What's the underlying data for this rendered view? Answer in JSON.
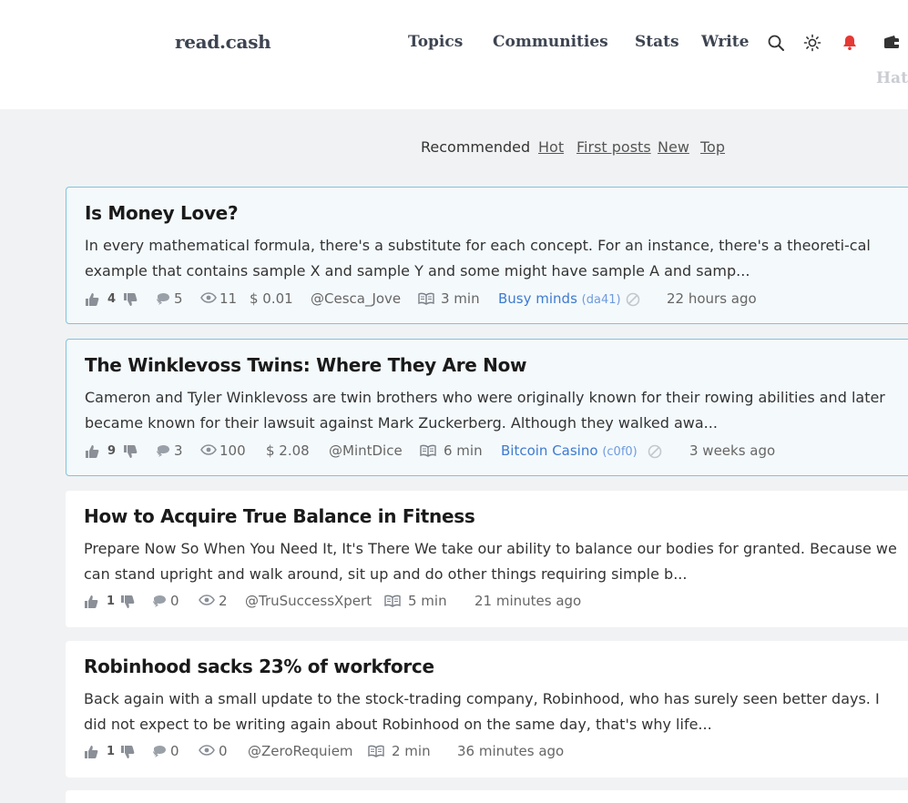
{
  "header": {
    "logo": "read.cash",
    "nav": [
      "Topics",
      "Communities",
      "Stats",
      "Write"
    ],
    "faded_text": "Hatt",
    "icons": [
      "search-icon",
      "sun-icon",
      "bell-icon",
      "wallet-icon"
    ],
    "bell_color": "#e53935"
  },
  "sort": {
    "active": "Recommended",
    "links": [
      "Hot",
      "First posts",
      "New",
      "Top"
    ]
  },
  "articles": [
    {
      "title": "Is Money Love?",
      "excerpt": "In every mathematical formula, there's a substitute for each concept. For an instance, there's a theoreti-cal example that contains sample X and sample Y and some might have sample A and samp...",
      "likes": "4",
      "comments": "5",
      "views": "11",
      "tips": "$ 0.01",
      "author": "@Cesca_Jove",
      "read_time": "3 min",
      "community": "Busy minds",
      "community_id": "(da41)",
      "time": "22 hours ago"
    },
    {
      "title": "The Winklevoss Twins: Where They Are Now",
      "excerpt": "Cameron and Tyler Winklevoss are twin brothers who were originally known for their rowing abilities and later became known for their lawsuit against Mark Zuckerberg. Although they walked awa...",
      "likes": "9",
      "comments": "3",
      "views": "100",
      "tips": "$ 2.08",
      "author": "@MintDice",
      "read_time": "6 min",
      "community": "Bitcoin Casino",
      "community_id": "(c0f0)",
      "time": "3 weeks ago"
    },
    {
      "title": "How to Acquire True Balance in Fitness",
      "excerpt": "Prepare Now So When You Need It, It's There We take our ability to balance our bodies for granted. Because we can stand upright and walk around, sit up and do other things requiring simple b...",
      "likes": "1",
      "comments": "0",
      "views": "2",
      "author": "@TruSuccessXpert",
      "read_time": "5 min",
      "time": "21 minutes ago"
    },
    {
      "title": "Robinhood sacks 23% of workforce",
      "excerpt": "Back again with a small update to the stock-trading company, Robinhood, who has surely seen better days. I did not expect to be writing again about Robinhood on the same day, that's why life...",
      "likes": "1",
      "comments": "0",
      "views": "0",
      "author": "@ZeroRequiem",
      "read_time": "2 min",
      "time": "36 minutes ago"
    }
  ]
}
